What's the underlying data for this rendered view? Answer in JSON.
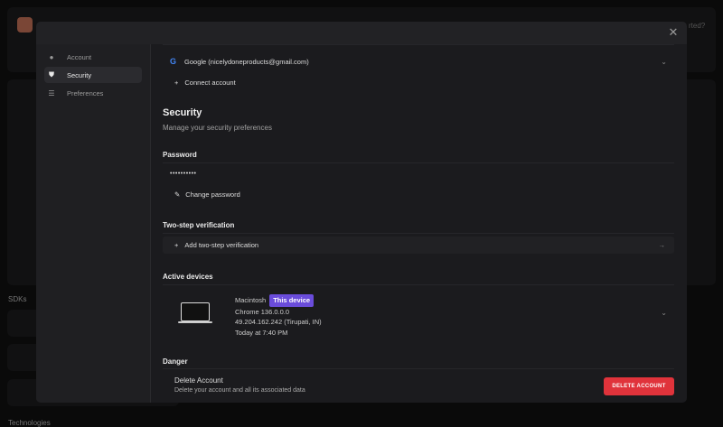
{
  "background": {
    "partial_text": "rted?",
    "sdks_label": "SDKs",
    "technologies_label": "Technologies"
  },
  "sidebar": {
    "items": [
      {
        "label": "Account",
        "icon": "user-icon"
      },
      {
        "label": "Security",
        "icon": "shield-icon"
      },
      {
        "label": "Preferences",
        "icon": "sliders-icon"
      }
    ]
  },
  "connected": {
    "google_label": "Google (nicelydoneproducts@gmail.com)",
    "connect_label": "Connect account"
  },
  "security": {
    "title": "Security",
    "subtitle": "Manage your security preferences"
  },
  "password": {
    "heading": "Password",
    "value": "••••••••••",
    "change_label": "Change password"
  },
  "two_step": {
    "heading": "Two-step verification",
    "add_label": "Add two-step verification"
  },
  "devices": {
    "heading": "Active devices",
    "name": "Macintosh",
    "badge": "This device",
    "browser": "Chrome 136.0.0.0",
    "ip": "49.204.162.242 (Tirupati, IN)",
    "time": "Today at 7:40 PM"
  },
  "danger": {
    "heading": "Danger",
    "title": "Delete Account",
    "desc": "Delete your account and all its associated data",
    "button": "DELETE ACCOUNT"
  },
  "colors": {
    "accent": "#6a4cdb",
    "danger": "#e0333b"
  }
}
